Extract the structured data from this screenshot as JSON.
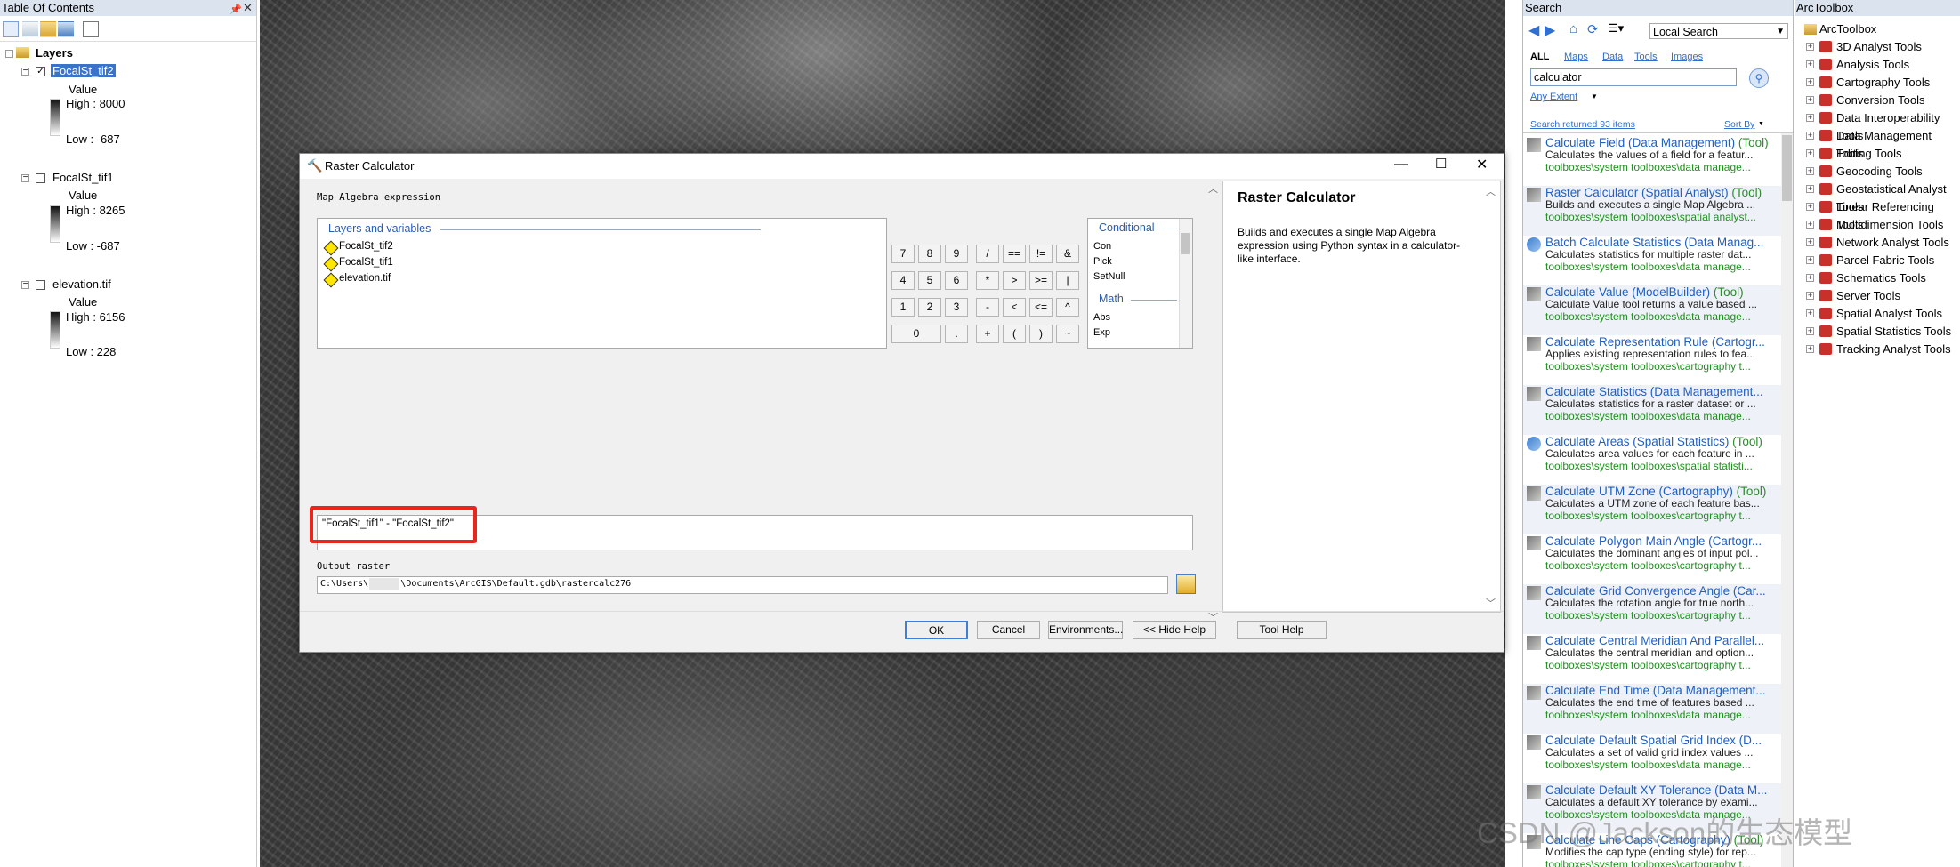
{
  "toc": {
    "title": "Table Of Contents",
    "root": "Layers",
    "layers": [
      {
        "name": "FocalSt_tif2",
        "checked": true,
        "value_label": "Value",
        "high": "High : 8000",
        "low": "Low : -687"
      },
      {
        "name": "FocalSt_tif1",
        "checked": false,
        "value_label": "Value",
        "high": "High : 8265",
        "low": "Low : -687"
      },
      {
        "name": "elevation.tif",
        "checked": false,
        "value_label": "Value",
        "high": "High : 6156",
        "low": "Low : 228"
      }
    ]
  },
  "dialog": {
    "title": "Raster Calculator",
    "expression_label": "Map Algebra expression",
    "layers_group_label": "Layers and variables",
    "layer_items": [
      "FocalSt_tif2",
      "FocalSt_tif1",
      "elevation.tif"
    ],
    "keypad": [
      [
        "7",
        "8",
        "9",
        "/",
        "==",
        "!=",
        "&"
      ],
      [
        "4",
        "5",
        "6",
        "*",
        ">",
        ">=",
        "|"
      ],
      [
        "1",
        "2",
        "3",
        "-",
        "<",
        "<=",
        "^"
      ],
      [
        "0",
        ".",
        "+",
        "(",
        ")",
        "~"
      ]
    ],
    "functions": {
      "group1": "Conditional",
      "group1_items": [
        "Con",
        "Pick",
        "SetNull"
      ],
      "group2": "Math",
      "group2_items": [
        "Abs",
        "Exp"
      ]
    },
    "expression": "\"FocalSt_tif1\" - \"FocalSt_tif2\"",
    "output_label": "Output raster",
    "output_value": "C:\\Users\\      \\Documents\\ArcGIS\\Default.gdb\\rastercalc276",
    "help_title": "Raster Calculator",
    "help_text": "Builds and executes a single Map Algebra expression using Python syntax in a calculator-like interface.",
    "buttons": {
      "ok": "OK",
      "cancel": "Cancel",
      "environments": "Environments...",
      "hide_help": "<< Hide Help",
      "tool_help": "Tool Help"
    }
  },
  "search": {
    "title": "Search",
    "scope": "Local Search",
    "tabs": [
      "ALL",
      "Maps",
      "Data",
      "Tools",
      "Images"
    ],
    "query": "calculator",
    "extent": "Any Extent",
    "returned": "Search returned 93 items",
    "sort": "Sort By",
    "results": [
      {
        "title": "Calculate Field (Data Management)",
        "tag": "(Tool)",
        "desc": "Calculates the values of a field for a featur...",
        "path": "toolboxes\\system toolboxes\\data manage..."
      },
      {
        "title": "Raster Calculator (Spatial Analyst)",
        "tag": "(Tool)",
        "desc": "Builds and executes a single Map Algebra ...",
        "path": "toolboxes\\system toolboxes\\spatial analyst..."
      },
      {
        "title": "Batch Calculate Statistics (Data Manag...",
        "tag": "",
        "desc": "Calculates statistics for multiple raster dat...",
        "path": "toolboxes\\system toolboxes\\data manage..."
      },
      {
        "title": "Calculate Value (ModelBuilder)",
        "tag": "(Tool)",
        "desc": "Calculate Value tool returns a value based ...",
        "path": "toolboxes\\system toolboxes\\data manage..."
      },
      {
        "title": "Calculate Representation Rule (Cartogr...",
        "tag": "",
        "desc": "Applies existing representation rules to fea...",
        "path": "toolboxes\\system toolboxes\\cartography t..."
      },
      {
        "title": "Calculate Statistics (Data Management...",
        "tag": "",
        "desc": "Calculates statistics for a raster dataset or ...",
        "path": "toolboxes\\system toolboxes\\data manage..."
      },
      {
        "title": "Calculate Areas (Spatial Statistics)",
        "tag": "(Tool)",
        "desc": "Calculates area values for each feature in ...",
        "path": "toolboxes\\system toolboxes\\spatial statisti..."
      },
      {
        "title": "Calculate UTM Zone (Cartography)",
        "tag": "(Tool)",
        "desc": "Calculates a UTM zone of each feature bas...",
        "path": "toolboxes\\system toolboxes\\cartography t..."
      },
      {
        "title": "Calculate Polygon Main Angle (Cartogr...",
        "tag": "",
        "desc": "Calculates the dominant angles of input pol...",
        "path": "toolboxes\\system toolboxes\\cartography t..."
      },
      {
        "title": "Calculate Grid Convergence Angle (Car...",
        "tag": "",
        "desc": "Calculates the rotation angle for true north...",
        "path": "toolboxes\\system toolboxes\\cartography t..."
      },
      {
        "title": "Calculate Central Meridian And Parallel...",
        "tag": "",
        "desc": "Calculates the central meridian and option...",
        "path": "toolboxes\\system toolboxes\\cartography t..."
      },
      {
        "title": "Calculate End Time (Data Management...",
        "tag": "",
        "desc": "Calculates the end time of features based ...",
        "path": "toolboxes\\system toolboxes\\data manage..."
      },
      {
        "title": "Calculate Default Spatial Grid Index (D...",
        "tag": "",
        "desc": "Calculates a set of valid grid index values ...",
        "path": "toolboxes\\system toolboxes\\data manage..."
      },
      {
        "title": "Calculate Default XY Tolerance (Data M...",
        "tag": "",
        "desc": "Calculates a default XY tolerance by exami...",
        "path": "toolboxes\\system toolboxes\\data manage..."
      },
      {
        "title": "Calculate Line Caps (Cartography)",
        "tag": "(Tool)",
        "desc": "Modifies the cap type (ending style) for rep...",
        "path": "toolboxes\\system toolboxes\\cartography t..."
      }
    ]
  },
  "arctoolbox": {
    "title": "ArcToolbox",
    "root": "ArcToolbox",
    "items": [
      "3D Analyst Tools",
      "Analysis Tools",
      "Cartography Tools",
      "Conversion Tools",
      "Data Interoperability Tools",
      "Data Management Tools",
      "Editing Tools",
      "Geocoding Tools",
      "Geostatistical Analyst Tools",
      "Linear Referencing Tools",
      "Multidimension Tools",
      "Network Analyst Tools",
      "Parcel Fabric Tools",
      "Schematics Tools",
      "Server Tools",
      "Spatial Analyst Tools",
      "Spatial Statistics Tools",
      "Tracking Analyst Tools"
    ]
  },
  "watermark": "CSDN @Jackson的生态模型"
}
